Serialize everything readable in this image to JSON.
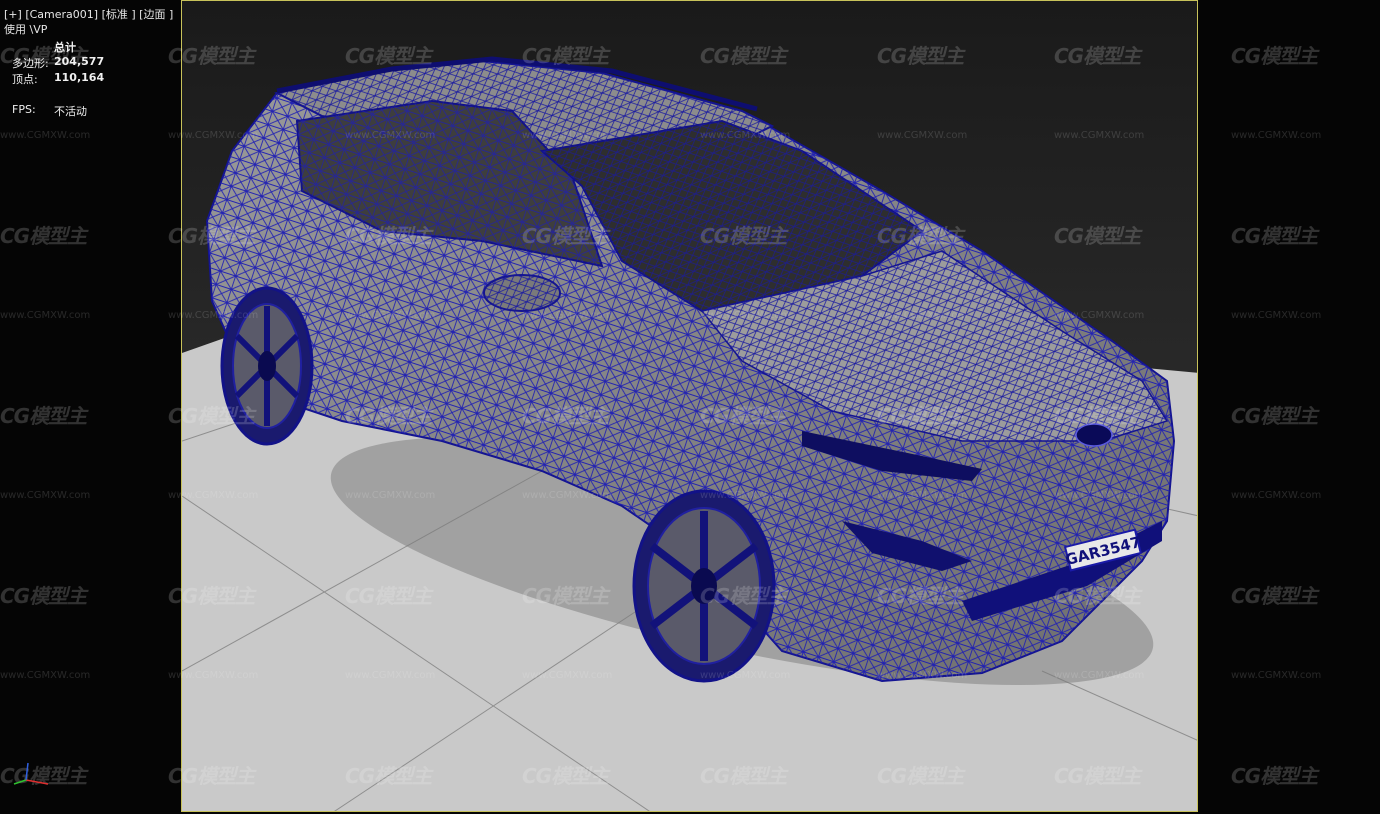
{
  "viewport": {
    "label_menu": "[+]",
    "label_camera": "[Camera001]",
    "label_shading_standard": "[标准 ]",
    "label_shading_edges": "[边面 ]",
    "label_vp_use": "使用 \\VP"
  },
  "stats": {
    "header": "总计",
    "polygons_label": "多边形:",
    "polygons_value": "204,577",
    "vertices_label": "顶点:",
    "vertices_value": "110,164",
    "fps_label": "FPS:",
    "fps_value": "不活动"
  },
  "watermark": {
    "logo_text": "CG模型主",
    "url_text": "www.CGMXW.com"
  },
  "model": {
    "license_plate": "GAR3547",
    "wire_color": "#1a1aa8",
    "body_color": "#8a8a8a",
    "floor_color": "#c9c9c9"
  },
  "colors": {
    "frame_border": "#c8c25a",
    "background": "#050505"
  }
}
